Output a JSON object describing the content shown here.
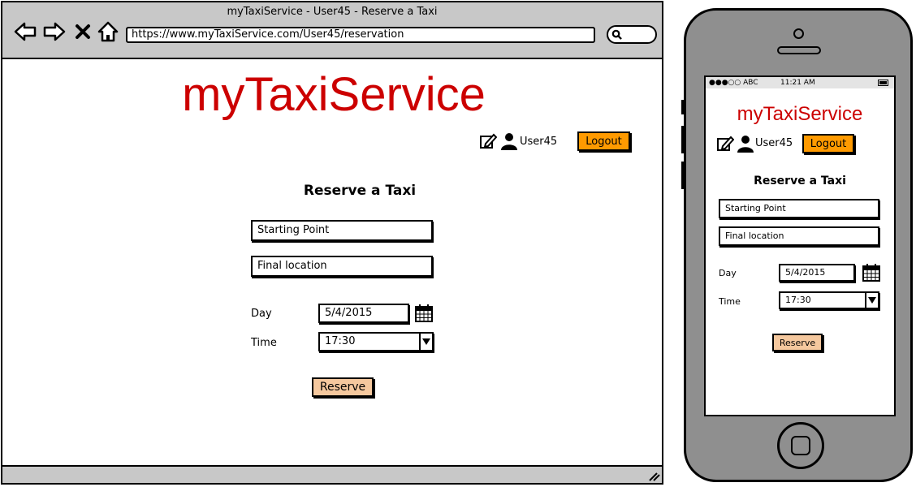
{
  "browser": {
    "window_title": "myTaxiService - User45 - Reserve a Taxi",
    "url": "https://www.myTaxiService.com/User45/reservation"
  },
  "app": {
    "logo": "myTaxiService",
    "username": "User45",
    "logout_label": "Logout",
    "form_title": "Reserve a Taxi",
    "starting_point": "Starting Point",
    "final_location": "Final location",
    "day_label": "Day",
    "day_value": "5/4/2015",
    "time_label": "Time",
    "time_value": "17:30",
    "reserve_label": "Reserve"
  },
  "phone": {
    "carrier": "●●●○○ ABC",
    "clock": "11:21 AM"
  },
  "colors": {
    "brand": "#cc0000",
    "logout_button": "#ff9a00",
    "reserve_button": "#f5c89e",
    "chrome_gray": "#c8c8c8",
    "phone_body": "#8f8f8f"
  },
  "icons": [
    "back-arrow-icon",
    "forward-arrow-icon",
    "close-x-icon",
    "home-icon",
    "search-icon",
    "edit-icon",
    "user-icon",
    "calendar-icon",
    "chevron-down-icon",
    "resize-grip-icon",
    "battery-icon"
  ]
}
